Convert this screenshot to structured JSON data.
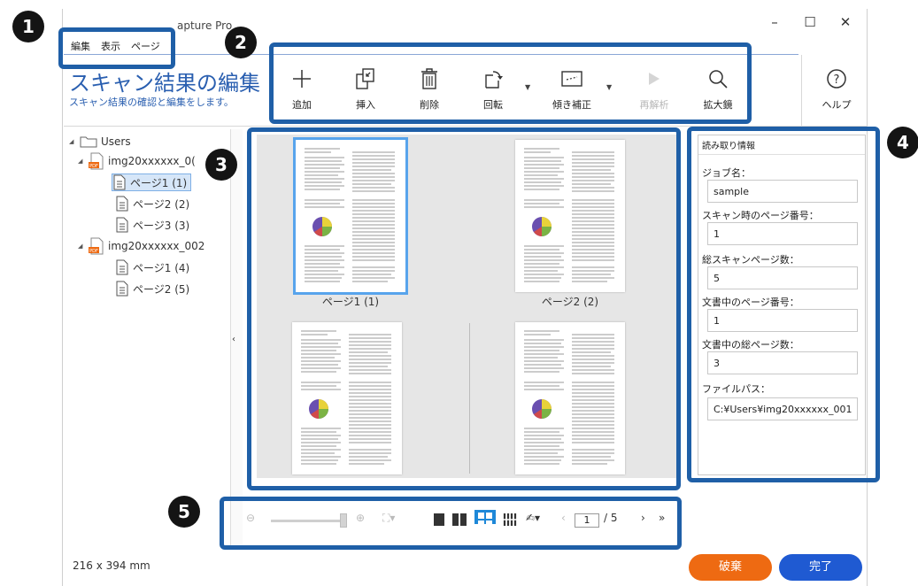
{
  "window": {
    "title_fragment": "apture Pro",
    "controls": [
      "–",
      "☐",
      "✕"
    ]
  },
  "menu": [
    "編集",
    "表示",
    "ページ"
  ],
  "header": {
    "title": "スキャン結果の編集",
    "subtitle": "スキャン結果の確認と編集をします。"
  },
  "toolbar": [
    {
      "label": "追加",
      "icon": "plus-icon",
      "enabled": true
    },
    {
      "label": "挿入",
      "icon": "insert-page-icon",
      "enabled": true
    },
    {
      "label": "削除",
      "icon": "trash-icon",
      "enabled": true
    },
    {
      "label": "回転",
      "icon": "rotate-icon",
      "enabled": true,
      "dropdown": true
    },
    {
      "label": "傾き補正",
      "icon": "deskew-icon",
      "enabled": true,
      "dropdown": true
    },
    {
      "label": "再解析",
      "icon": "play-icon",
      "enabled": false
    },
    {
      "label": "拡大鏡",
      "icon": "magnifier-icon",
      "enabled": true
    }
  ],
  "help": {
    "label": "ヘルプ",
    "icon": "help-icon"
  },
  "tree": {
    "root": "Users",
    "files": [
      {
        "name": "img20xxxxxx_0(",
        "pages": [
          "ページ1 (1)",
          "ページ2 (2)",
          "ページ3 (3)"
        ]
      },
      {
        "name": "img20xxxxxx_002",
        "pages": [
          "ページ1 (4)",
          "ページ2 (5)"
        ]
      }
    ],
    "selected": "ページ1 (1)"
  },
  "preview": {
    "labels": [
      "ページ1 (1)",
      "ページ2 (2)"
    ]
  },
  "info": {
    "title": "読み取り情報",
    "fields": [
      {
        "label": "ジョブ名：",
        "value": "sample"
      },
      {
        "label": "スキャン時のページ番号：",
        "value": "1"
      },
      {
        "label": "総スキャンページ数：",
        "value": "5"
      },
      {
        "label": "文書中のページ番号：",
        "value": "1"
      },
      {
        "label": "文書中の総ページ数：",
        "value": "3"
      },
      {
        "label": "ファイルパス：",
        "value": "C:¥Users¥img20xxxxxx_001"
      }
    ]
  },
  "pager": {
    "current": "1",
    "total": "/  5"
  },
  "status": {
    "size": "216 x 394 mm"
  },
  "buttons": {
    "discard": "破棄",
    "done": "完了"
  },
  "callouts": [
    "1",
    "2",
    "3",
    "4",
    "5"
  ],
  "colors": {
    "accent": "#1f5fa7",
    "discard": "#ee6a12",
    "done": "#1f5ad2",
    "heading": "#2a5fb0"
  }
}
